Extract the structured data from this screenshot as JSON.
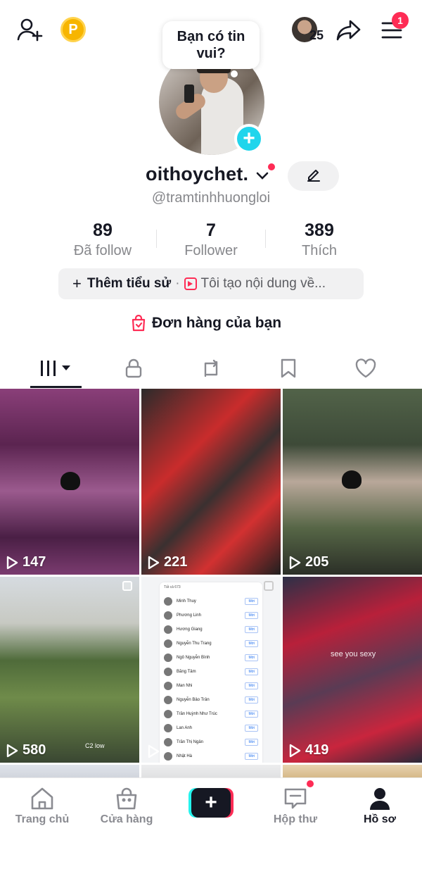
{
  "header": {
    "add_friend_icon": "add-user-icon",
    "coin_label": "P",
    "friends_count": "25",
    "share_icon": "share-arrow-icon",
    "menu_icon": "hamburger-menu-icon",
    "menu_badge": "1"
  },
  "profile": {
    "bubble_text": "Bạn có tin vui?",
    "username": "oithoychet.",
    "handle": "@tramtinhhuongloi",
    "add_icon": "plus-icon",
    "edit_icon": "pencil-icon"
  },
  "stats": [
    {
      "value": "89",
      "label": "Đã follow"
    },
    {
      "value": "7",
      "label": "Follower"
    },
    {
      "value": "389",
      "label": "Thích"
    }
  ],
  "bio": {
    "add_label": "Thêm tiểu sử",
    "separator": "·",
    "content_label": "Tôi tạo nội dung về..."
  },
  "orders": {
    "label": "Đơn hàng của bạn"
  },
  "tabs": [
    {
      "icon": "videos-grid-icon",
      "active": true
    },
    {
      "icon": "lock-icon"
    },
    {
      "icon": "repost-icon"
    },
    {
      "icon": "bookmark-icon"
    },
    {
      "icon": "heart-icon"
    }
  ],
  "videos": [
    {
      "views": "147"
    },
    {
      "views": "221"
    },
    {
      "views": "205"
    },
    {
      "views": "580",
      "caption": "C2 low"
    },
    {
      "views": "",
      "list": {
        "header": "Tất cả 673",
        "names": [
          "Minh Thuy",
          "Phương Linh",
          "Hương Giang",
          "Nguyễn Thu Trang",
          "Ngô Nguyễn Bình",
          "Băng Tâm",
          "Man Nhi",
          "Nguyễn Bảo Trân",
          "Trần Huỳnh Như Trúc",
          "Lan Anh",
          "Trần Thị Ngân",
          "Nhật Hà"
        ],
        "button": "Mời"
      }
    },
    {
      "views": "419",
      "caption": "see  you  sexy"
    }
  ],
  "bottom_nav": [
    {
      "label": "Trang chủ",
      "icon": "home-icon"
    },
    {
      "label": "Cửa hàng",
      "icon": "shop-bag-icon"
    },
    {
      "label": "+",
      "icon": "create-icon"
    },
    {
      "label": "Hộp thư",
      "icon": "inbox-icon"
    },
    {
      "label": "Hồ sơ",
      "icon": "profile-icon",
      "active": true
    }
  ],
  "colors": {
    "accent_red": "#fe2c55",
    "accent_cyan": "#20d5ec",
    "text_primary": "#161823",
    "text_secondary": "#86878b"
  }
}
